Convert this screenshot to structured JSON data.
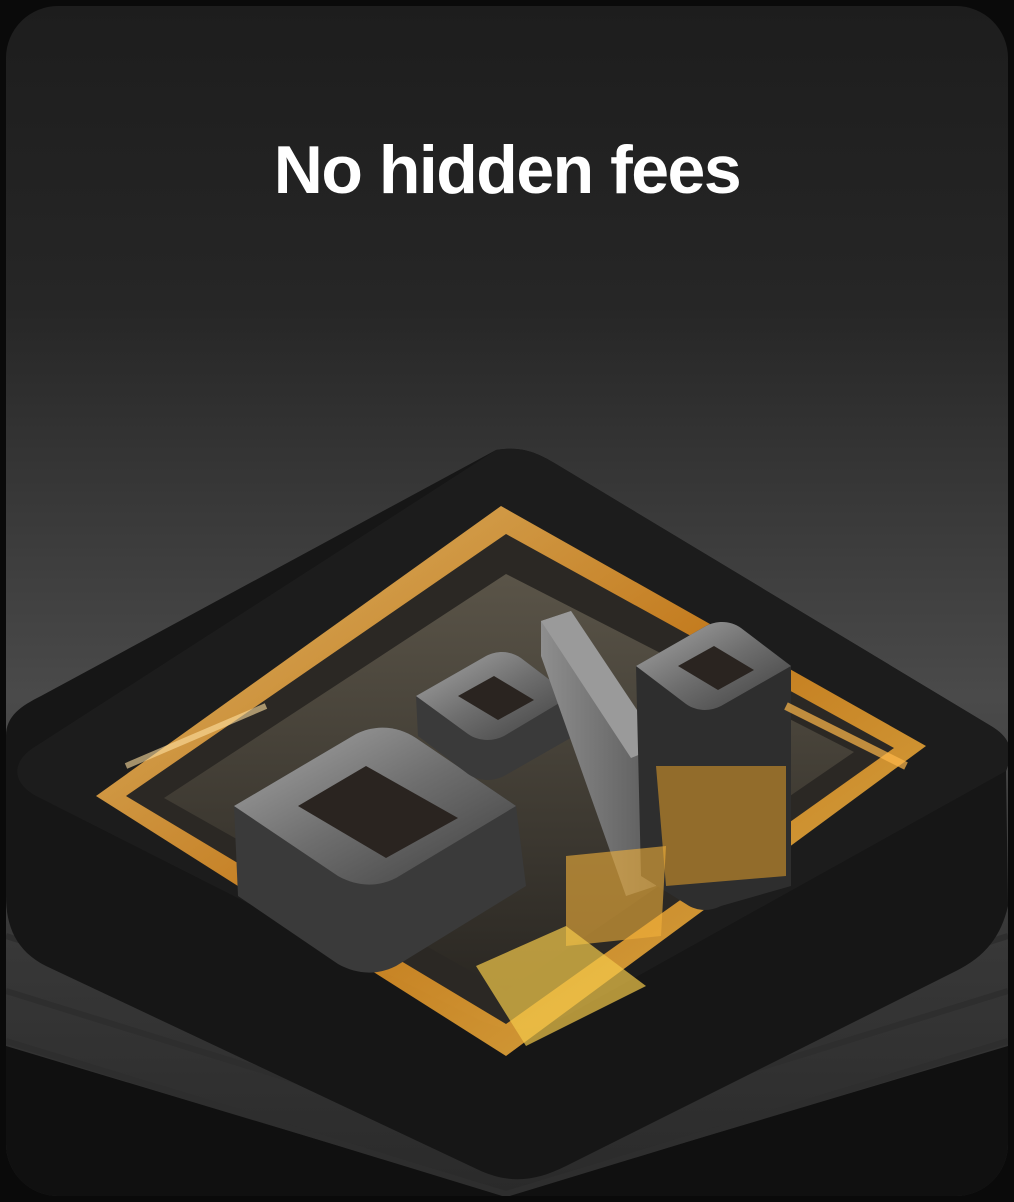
{
  "card": {
    "title": "No hidden fees",
    "illustration": {
      "subject": "zero-percent-icon",
      "accent_color": "#f5a623",
      "metal_color": "#7a7a7a",
      "base_color": "#141414"
    }
  }
}
